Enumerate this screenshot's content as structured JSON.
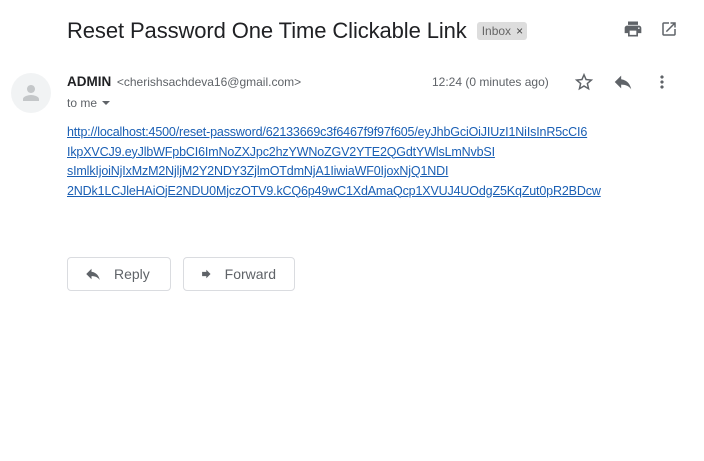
{
  "email": {
    "subject": "Reset Password One Time Clickable Link",
    "label": "Inbox",
    "label_remove": "×",
    "sender_name": "ADMIN",
    "sender_email": "<cherishsachdeva16@gmail.com>",
    "to_line": "to me",
    "timestamp": "12:24 (0 minutes ago)",
    "body_link_lines": [
      "http://localhost:4500/reset-password/62133669c3f6467f9f97f605/eyJhbGciOiJIUzI1NiIsInR5cCI6",
      "IkpXVCJ9.eyJlbWFpbCI6ImNoZXJpc2hzYWNoZGV2YTE2QGdtYWlsLmNvbSI",
      "sImlkIjoiNjIxMzM2NjljM2Y2NDY3ZjlmOTdmNjA1IiwiaWF0IjoxNjQ1NDI",
      "2NDk1LCJleHAiOjE2NDU0MjczOTV9.kCQ6p49wC1XdAmaQcp1XVUJ4UOdgZ5KqZut0pR2BDcw"
    ]
  },
  "actions": {
    "reply_label": "Reply",
    "forward_label": "Forward"
  },
  "icons": {
    "print": "print-icon",
    "open_new_window": "open-in-new-window-icon",
    "star": "star-icon",
    "reply": "reply-icon",
    "more": "more-vert-icon",
    "avatar": "person-icon",
    "forward": "forward-icon"
  },
  "colors": {
    "link": "#1a5fb4",
    "chip_bg": "#dddddd",
    "icon": "#5f6368"
  }
}
